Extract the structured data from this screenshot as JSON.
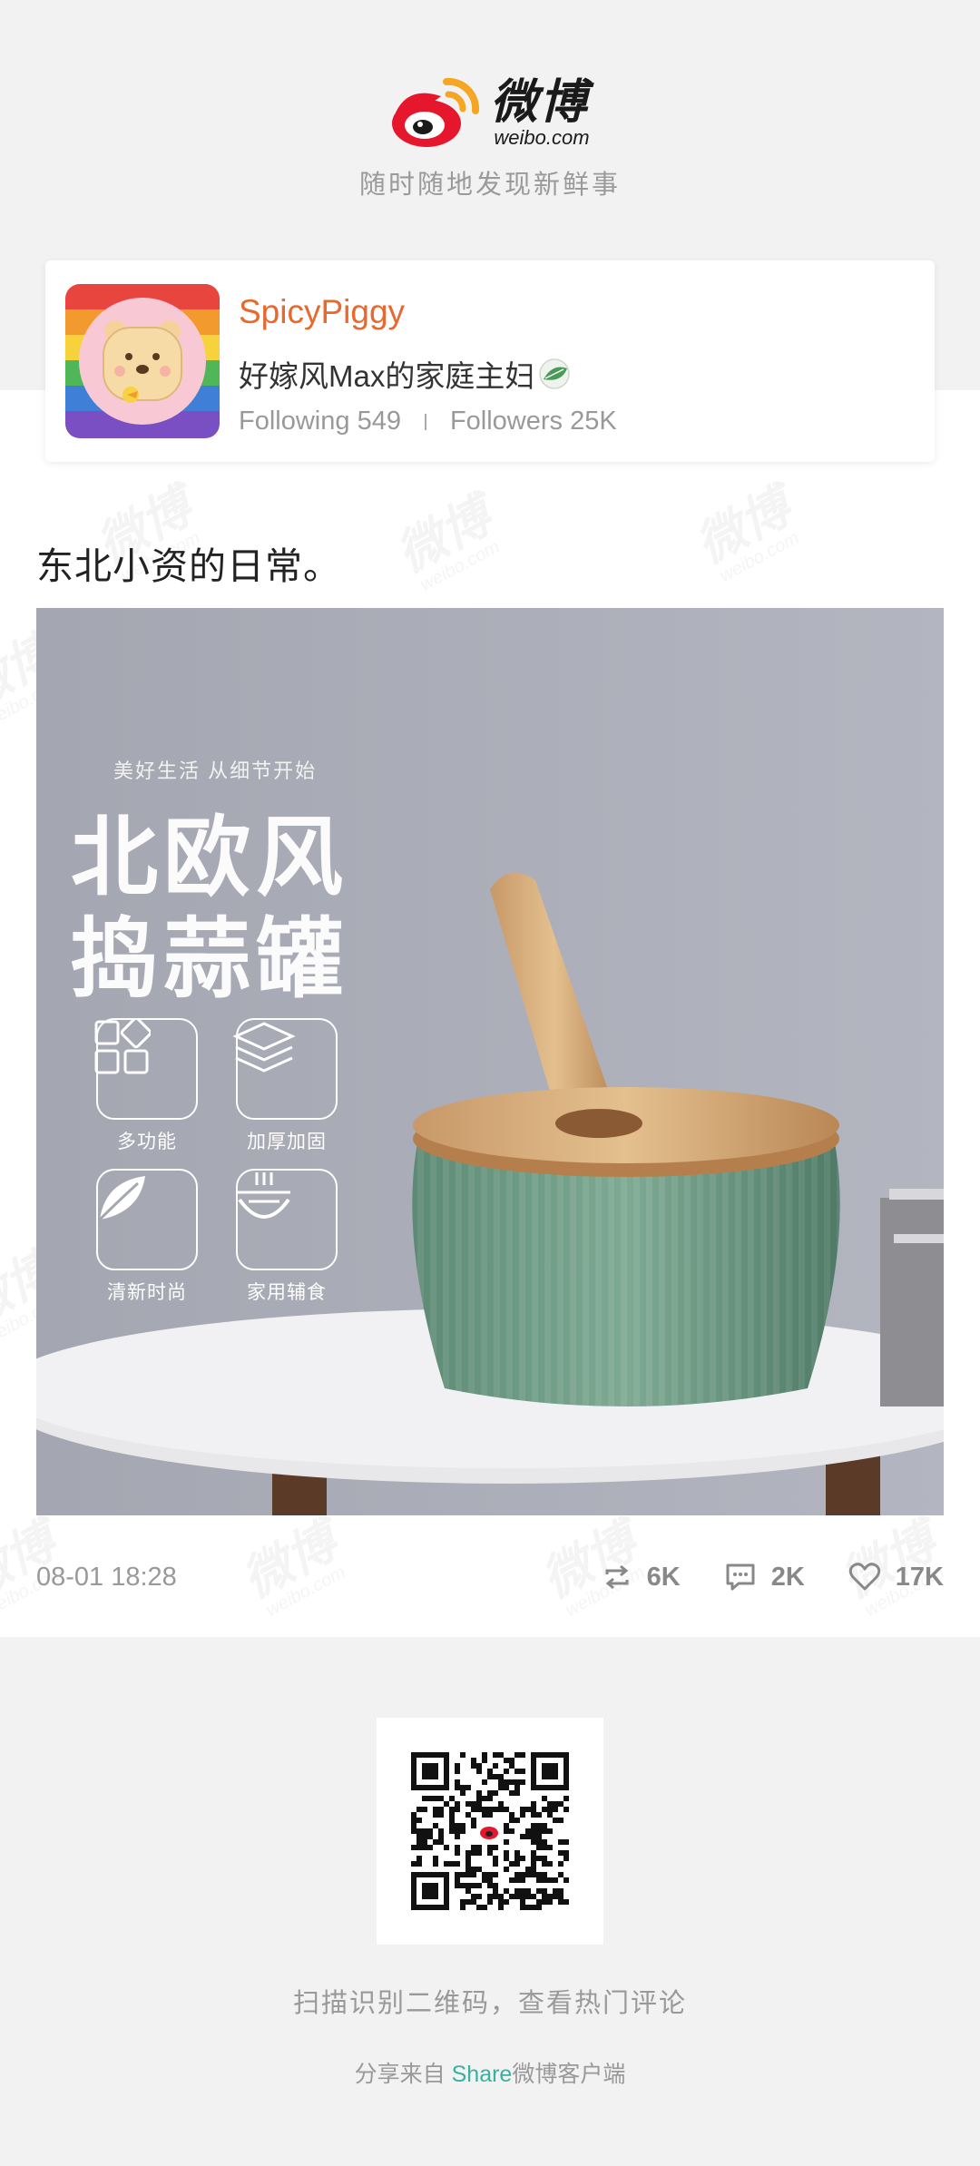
{
  "brand": {
    "logo_cn": "微博",
    "logo_en": "weibo.com",
    "tagline": "随时随地发现新鲜事",
    "watermark_cn": "微博",
    "watermark_en": "weibo.com"
  },
  "profile": {
    "name": "SpicyPiggy",
    "bio": "好嫁风Max的家庭主妇",
    "following_label": "Following",
    "following_count": "549",
    "followers_label": "Followers",
    "followers_count": "25K"
  },
  "post": {
    "text": "东北小资的日常。",
    "image": {
      "subtitle": "美好生活 从细节开始",
      "title_line1": "北欧风",
      "title_line2": "捣蒜罐",
      "features": [
        "多功能",
        "加厚加固",
        "清新时尚",
        "家用辅食"
      ]
    },
    "timestamp": "08-01 18:28",
    "reposts": "6K",
    "comments": "2K",
    "likes": "17K"
  },
  "footer": {
    "qr_hint": "扫描识别二维码，查看热门评论",
    "share_prefix": "分享来自 ",
    "share_highlight": "Share",
    "share_suffix": "微博客户端"
  },
  "colors": {
    "accent_orange": "#e8682e",
    "share_teal": "#3ab0a0",
    "weibo_red": "#e6162d",
    "weibo_gold": "#f5a623"
  },
  "icons": [
    "weibo-logo-icon",
    "leaf-emoji-icon",
    "repost-icon",
    "comment-icon",
    "like-icon",
    "qr-code"
  ]
}
